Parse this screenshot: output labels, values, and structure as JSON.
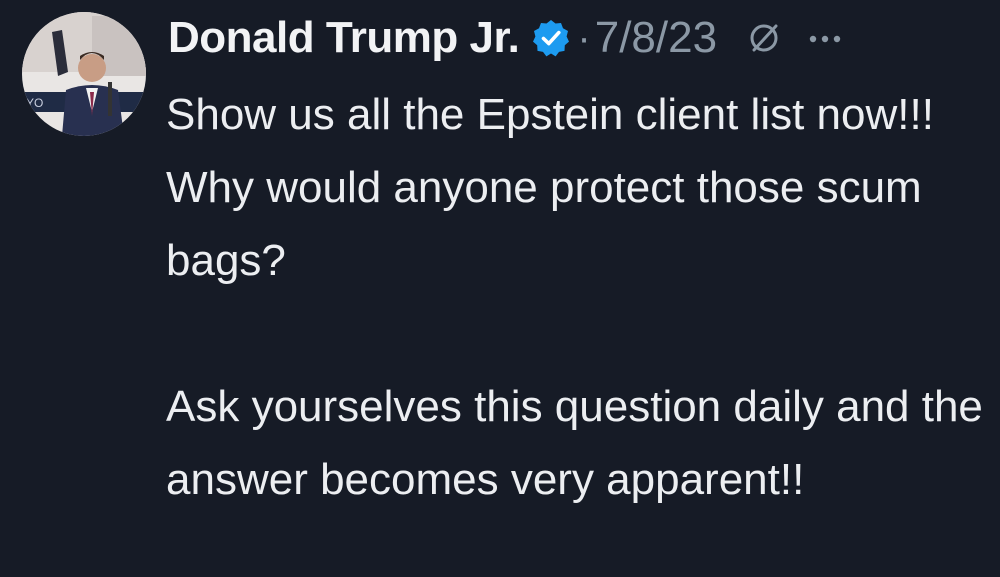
{
  "tweet": {
    "author": {
      "display_name": "Donald Trump Jr.",
      "verified": true,
      "verified_color": "#1d9bf0",
      "avatar_icon": "avatar-photo"
    },
    "separator": "·",
    "date": "7/8/23",
    "grok_icon": "grok-icon",
    "more_icon": "more-options-icon",
    "paragraphs": [
      "Show us all the Epstein client list now!!! Why would anyone protect those scum bags?",
      "Ask yourselves this question daily and the answer becomes very apparent!!"
    ]
  },
  "colors": {
    "background": "#161b26",
    "text": "#e7e9ea",
    "muted": "#8b98a5"
  }
}
